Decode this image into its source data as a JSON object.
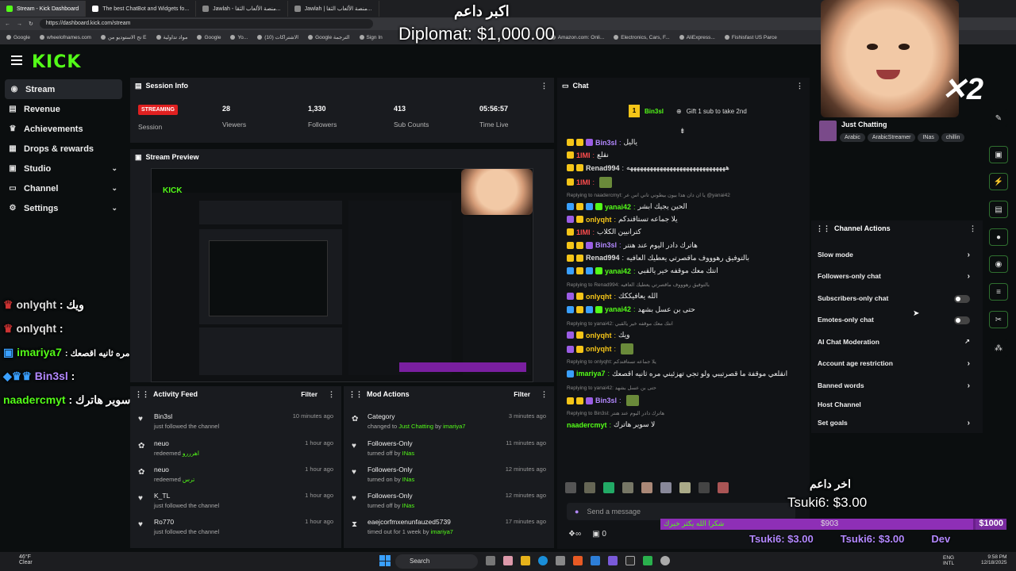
{
  "browser": {
    "tabs": [
      {
        "label": "Stream - Kick Dashboard",
        "active": true
      },
      {
        "label": "The best ChatBot and Widgets fo..."
      },
      {
        "label": "Jawlah - منصة الألعاب الثقا..."
      },
      {
        "label": "Jawlah | منصة الألعاب الثقا..."
      }
    ],
    "url": "https://dashboard.kick.com/stream",
    "bookmarks": [
      "Google",
      "wheelofnames.com",
      "تح الاستوديو من E",
      "مواد تداولية",
      "Google",
      "Yo...",
      "(10) الاشتراكات",
      "Google الترجمة",
      "Sign In",
      "Amazon.com: Onli...",
      "Electronics, Cars, F...",
      "AliExpress...",
      "Fishisfast US Parce"
    ]
  },
  "overlay": {
    "top_arabic": "اكبر داعم",
    "top_diplomat": "Diplomat: $1,000.00",
    "bottom_arabic": "اخر داعم",
    "bottom_tsuki": "Tsuki6: $3.00",
    "goal_amount": "$903",
    "goal_target": "$1000",
    "goal_text": "شكرا الله يكثر خيرك",
    "ticker": [
      "Tsuki6: $3.00",
      "Tsuki6: $3.00",
      "Dev"
    ]
  },
  "logo": "KICK",
  "sidebar": {
    "items": [
      {
        "label": "Stream",
        "icon": "stream-icon"
      },
      {
        "label": "Revenue",
        "icon": "revenue-icon"
      },
      {
        "label": "Achievements",
        "icon": "trophy-icon"
      },
      {
        "label": "Drops & rewards",
        "icon": "gift-icon"
      },
      {
        "label": "Studio",
        "icon": "studio-icon"
      },
      {
        "label": "Channel",
        "icon": "channel-icon"
      },
      {
        "label": "Settings",
        "icon": "gear-icon"
      }
    ]
  },
  "session": {
    "title": "Session Info",
    "status": "STREAMING",
    "status_label": "Session",
    "viewers": "28",
    "viewers_label": "Viewers",
    "followers": "1,330",
    "followers_label": "Followers",
    "subs": "413",
    "subs_label": "Sub Counts",
    "time": "05:56:57",
    "time_label": "Time Live"
  },
  "preview": {
    "title": "Stream Preview"
  },
  "left_chat_overlay": [
    {
      "name": "onlyqht",
      "text": ": ويك"
    },
    {
      "name": "onlyqht",
      "text": ":"
    },
    {
      "name": "imariya7",
      "text": ": انقلعي موقفة ما قصرتيبي ولو تجي تهزئيني مره ثانيه اقصعك"
    },
    {
      "name": "Bin3sl",
      "text": ":"
    },
    {
      "name": "naadercmyt",
      "text": ": لا سوير هاترك"
    }
  ],
  "activity": {
    "title": "Activity Feed",
    "filter": "Filter",
    "rows": [
      {
        "name": "Bin3sl",
        "sub": "just followed the channel",
        "time": "10 minutes ago",
        "icon": "heart-icon"
      },
      {
        "name": "neuo",
        "sub": "redeemed",
        "extra": "اهرررو",
        "time": "1 hour ago",
        "icon": "reward-icon"
      },
      {
        "name": "neuo",
        "sub": "redeemed",
        "extra": "ترس",
        "time": "1 hour ago",
        "icon": "reward-icon"
      },
      {
        "name": "K_TL",
        "sub": "just followed the channel",
        "time": "1 hour ago",
        "icon": "heart-icon"
      },
      {
        "name": "Ro770",
        "sub": "just followed the channel",
        "time": "1 hour ago",
        "icon": "heart-icon"
      }
    ]
  },
  "mod": {
    "title": "Mod Actions",
    "filter": "Filter",
    "rows": [
      {
        "name": "Category",
        "sub": "changed to",
        "extra": "Just Chatting",
        "by": "by",
        "who": "imariya7",
        "time": "3 minutes ago",
        "icon": "category-icon"
      },
      {
        "name": "Followers-Only",
        "sub": "turned off by",
        "who": "INas",
        "time": "11 minutes ago",
        "icon": "heart-icon"
      },
      {
        "name": "Followers-Only",
        "sub": "turned on by",
        "who": "INas",
        "time": "12 minutes ago",
        "icon": "heart-icon"
      },
      {
        "name": "Followers-Only",
        "sub": "turned off by",
        "who": "INas",
        "time": "12 minutes ago",
        "icon": "heart-icon"
      },
      {
        "name": "eaejcorfmxenunfauzed5739",
        "sub": "timed out for 1 week by",
        "who": "imariya7",
        "time": "17 minutes ago",
        "icon": "timeout-icon"
      }
    ]
  },
  "chat": {
    "title": "Chat",
    "pinned_user": "Bin3sl",
    "pinned_count": "1",
    "gift_text": "Gift 1 sub to take 2nd",
    "input_placeholder": "Send a message",
    "points": "0",
    "messages": [
      {
        "name": "Bin3sl",
        "color": "#b388ff",
        "text": "ياليل",
        "badges": [
          "by",
          "by",
          "bp"
        ]
      },
      {
        "name": "1IMI",
        "color": "#ff4d4d",
        "text": "نقلع",
        "badges": [
          "by"
        ]
      },
      {
        "name": "Renad994",
        "color": "#ddd",
        "text": "ههههههههههههههههههههههههههههههه",
        "badges": [
          "by",
          "by"
        ]
      },
      {
        "name": "1IMI",
        "color": "#ff4d4d",
        "text": "",
        "badges": [
          "by"
        ]
      },
      {
        "reply": "Replying to naadercmyt: يا ان دان هذا بيون بيطوني تاني اس عر @yanai42"
      },
      {
        "name": "yanai42",
        "color": "#53fc18",
        "text": "الحين يجيك ابشر",
        "badges": [
          "bb",
          "by",
          "bb",
          "bg"
        ]
      },
      {
        "name": "onlyqht",
        "color": "#f5c518",
        "text": "يلا جماعه تستاقندكم",
        "badges": [
          "bp",
          "by"
        ]
      },
      {
        "name": "1IMI",
        "color": "#ff4d4d",
        "text": "كترانيين الكلاب",
        "badges": [
          "by"
        ]
      },
      {
        "name": "Bin3sl",
        "color": "#b388ff",
        "text": "هاترك دادر اليوم عند هنتر",
        "badges": [
          "by",
          "by",
          "bp"
        ]
      },
      {
        "name": "Renad994",
        "color": "#ddd",
        "text": "بالتوفيق رهوووف ماقصرتي يعطيك العافيه",
        "badges": [
          "by",
          "by"
        ]
      },
      {
        "name": "yanai42",
        "color": "#53fc18",
        "text": "انتك معك موقفه خير يالقبي",
        "badges": [
          "bb",
          "by",
          "bb",
          "bg"
        ]
      },
      {
        "reply": "Replying to Renad994: بالتوفيق رهوووف ماقصرتي يعطيك العافيه"
      },
      {
        "name": "onlyqht",
        "color": "#f5c518",
        "text": "الله يعافيككك",
        "badges": [
          "bp",
          "by"
        ]
      },
      {
        "name": "yanai42",
        "color": "#53fc18",
        "text": "حتى بن عسل بشهد",
        "badges": [
          "bb",
          "by",
          "bb",
          "bg"
        ]
      },
      {
        "reply": "Replying to yanai42: انتك معك موقفه خير يالقبي"
      },
      {
        "name": "onlyqht",
        "color": "#f5c518",
        "text": "ويك",
        "badges": [
          "bp",
          "by"
        ]
      },
      {
        "name": "onlyqht",
        "color": "#f5c518",
        "text": "",
        "badges": [
          "bp",
          "by"
        ]
      },
      {
        "reply": "Replying to onlyqht: يلا جماعه تستاقندكم"
      },
      {
        "name": "imariya7",
        "color": "#53fc18",
        "text": "انقلعي موقفة ما قصرتيبي ولو تجي تهزئيني مره ثانيه اقصعك",
        "badges": [
          "bb"
        ]
      },
      {
        "reply": "Replying to yanai42: حتى بن عسل بشهد"
      },
      {
        "name": "Bin3sl",
        "color": "#b388ff",
        "text": "",
        "badges": [
          "by",
          "by",
          "bp"
        ]
      },
      {
        "reply": "Replying to Bin3sl: هاترك دادر اليوم عند هنتر"
      },
      {
        "name": "naadercmyt",
        "color": "#53fc18",
        "text": "لا سوير هاترك",
        "badges": []
      }
    ]
  },
  "channel": {
    "category": "Just Chatting",
    "tags": [
      "Arabic",
      "ArabicStreamer",
      "INas",
      "chillin"
    ]
  },
  "channel_actions": {
    "title": "Channel Actions",
    "items": [
      {
        "label": "Slow mode",
        "control": "chevron"
      },
      {
        "label": "Followers-only chat",
        "control": "chevron"
      },
      {
        "label": "Subscribers-only chat",
        "control": "toggle"
      },
      {
        "label": "Emotes-only chat",
        "control": "toggle"
      },
      {
        "label": "AI Chat Moderation",
        "control": "external"
      },
      {
        "label": "Account age restriction",
        "control": "chevron"
      },
      {
        "label": "Banned words",
        "control": "chevron"
      },
      {
        "label": "Host Channel",
        "control": "none"
      },
      {
        "label": "Set goals",
        "control": "chevron"
      }
    ]
  },
  "taskbar": {
    "weather_temp": "46°F",
    "weather_text": "Clear",
    "search": "Search",
    "lang1": "ENG",
    "lang2": "INTL",
    "time": "9:58 PM",
    "date": "12/18/2025"
  }
}
